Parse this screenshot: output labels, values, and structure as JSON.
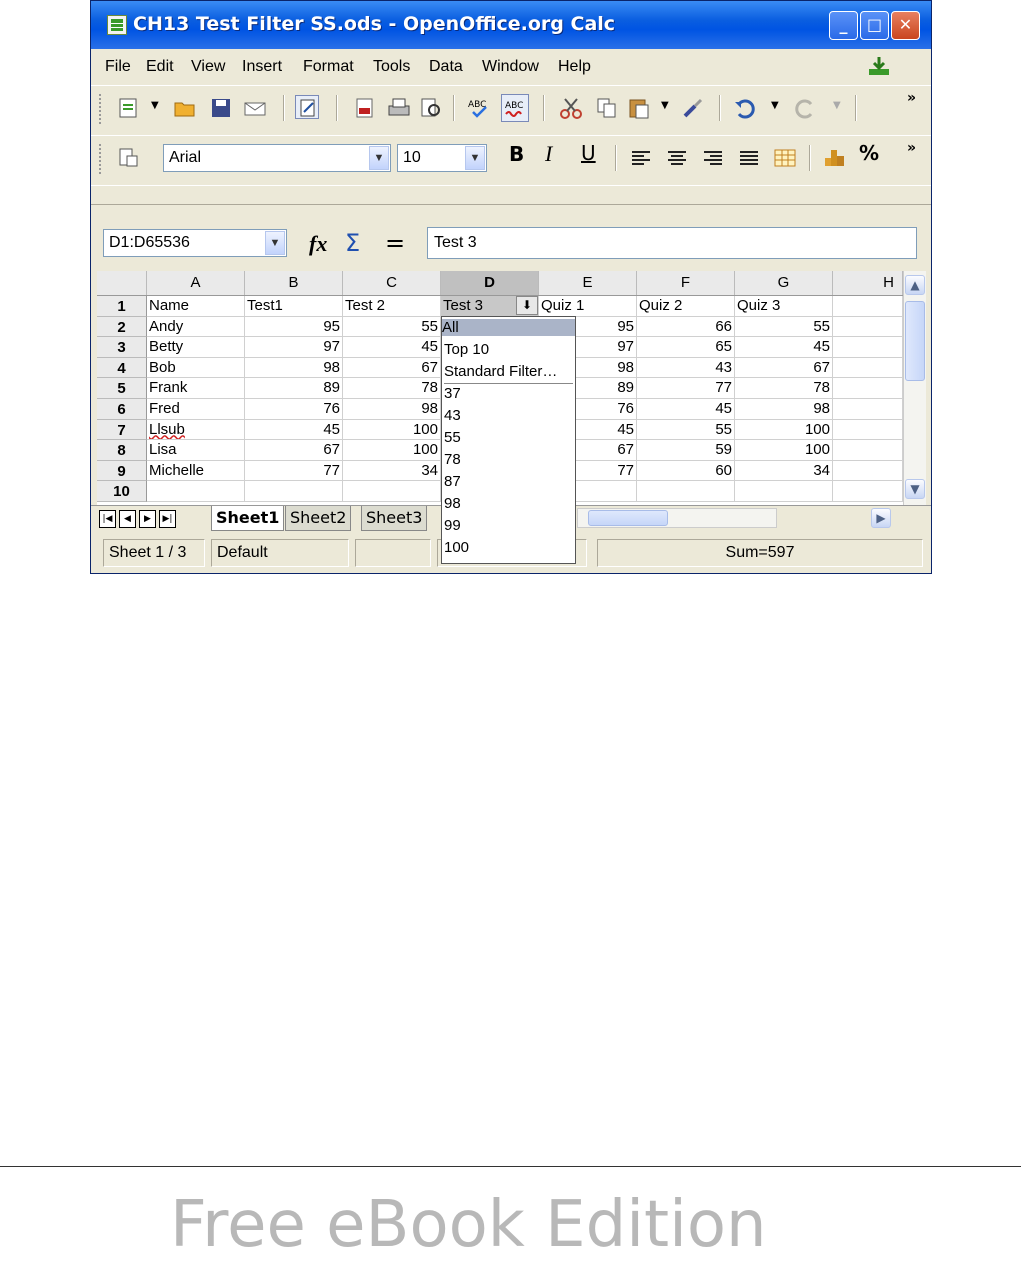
{
  "window": {
    "title": "CH13 Test Filter SS.ods - OpenOffice.org Calc",
    "controls": {
      "minimize": "_",
      "maximize": "□",
      "close": "✕"
    }
  },
  "menu": [
    "File",
    "Edit",
    "View",
    "Insert",
    "Format",
    "Tools",
    "Data",
    "Window",
    "Help"
  ],
  "formatting": {
    "font_name": "Arial",
    "font_size": "10",
    "bold": "B",
    "italic": "I",
    "underline": "U",
    "percent": "%"
  },
  "formula_bar": {
    "name_box": "D1:D65536",
    "function_wizard": "fx",
    "sum": "Σ",
    "equals": "=",
    "content": "Test 3"
  },
  "spreadsheet": {
    "columns": [
      "A",
      "B",
      "C",
      "D",
      "E",
      "F",
      "G",
      "H"
    ],
    "selected_column": "D",
    "rows": [
      {
        "num": "1",
        "cells": [
          "Name",
          "Test1",
          "Test 2",
          "Test 3",
          "Quiz 1",
          "Quiz 2",
          "Quiz 3",
          ""
        ]
      },
      {
        "num": "2",
        "cells": [
          "Andy",
          "95",
          "55",
          "",
          "95",
          "66",
          "55",
          ""
        ]
      },
      {
        "num": "3",
        "cells": [
          "Betty",
          "97",
          "45",
          "",
          "97",
          "65",
          "45",
          ""
        ]
      },
      {
        "num": "4",
        "cells": [
          "Bob",
          "98",
          "67",
          "",
          "98",
          "43",
          "67",
          ""
        ]
      },
      {
        "num": "5",
        "cells": [
          "Frank",
          "89",
          "78",
          "",
          "89",
          "77",
          "78",
          ""
        ]
      },
      {
        "num": "6",
        "cells": [
          "Fred",
          "76",
          "98",
          "",
          "76",
          "45",
          "98",
          ""
        ]
      },
      {
        "num": "7",
        "cells": [
          "Llsub",
          "45",
          "100",
          "",
          "45",
          "55",
          "100",
          ""
        ]
      },
      {
        "num": "8",
        "cells": [
          "Lisa",
          "67",
          "100",
          "",
          "67",
          "59",
          "100",
          ""
        ]
      },
      {
        "num": "9",
        "cells": [
          "Michelle",
          "77",
          "34",
          "",
          "77",
          "60",
          "34",
          ""
        ]
      },
      {
        "num": "10",
        "cells": [
          "",
          "",
          "",
          "",
          "",
          "",
          "",
          ""
        ]
      }
    ]
  },
  "autofilter_dropdown": {
    "items": [
      "All",
      "Top 10",
      "Standard Filter…",
      "37",
      "43",
      "55",
      "78",
      "87",
      "98",
      "99",
      "100"
    ],
    "selected": "All"
  },
  "sheet_tabs": [
    "Sheet1",
    "Sheet2",
    "Sheet3"
  ],
  "active_sheet": "Sheet1",
  "status_bar": {
    "sheet_info": "Sheet 1 / 3",
    "page_style": "Default",
    "sum": "Sum=597"
  },
  "footer": {
    "text": "Free eBook Edition"
  }
}
